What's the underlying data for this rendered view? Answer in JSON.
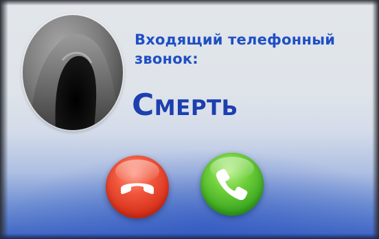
{
  "incoming_call": {
    "caption": "Входящий телефонный звонок:",
    "caller_name": "Смерть"
  },
  "controls": {
    "decline_icon": "hang-up-phone-icon",
    "accept_icon": "phone-icon"
  },
  "colors": {
    "caption_text": "#1f4fc4",
    "caller_text": "#1d3fae",
    "decline_button": "#e0442a",
    "accept_button": "#4fba2c"
  }
}
